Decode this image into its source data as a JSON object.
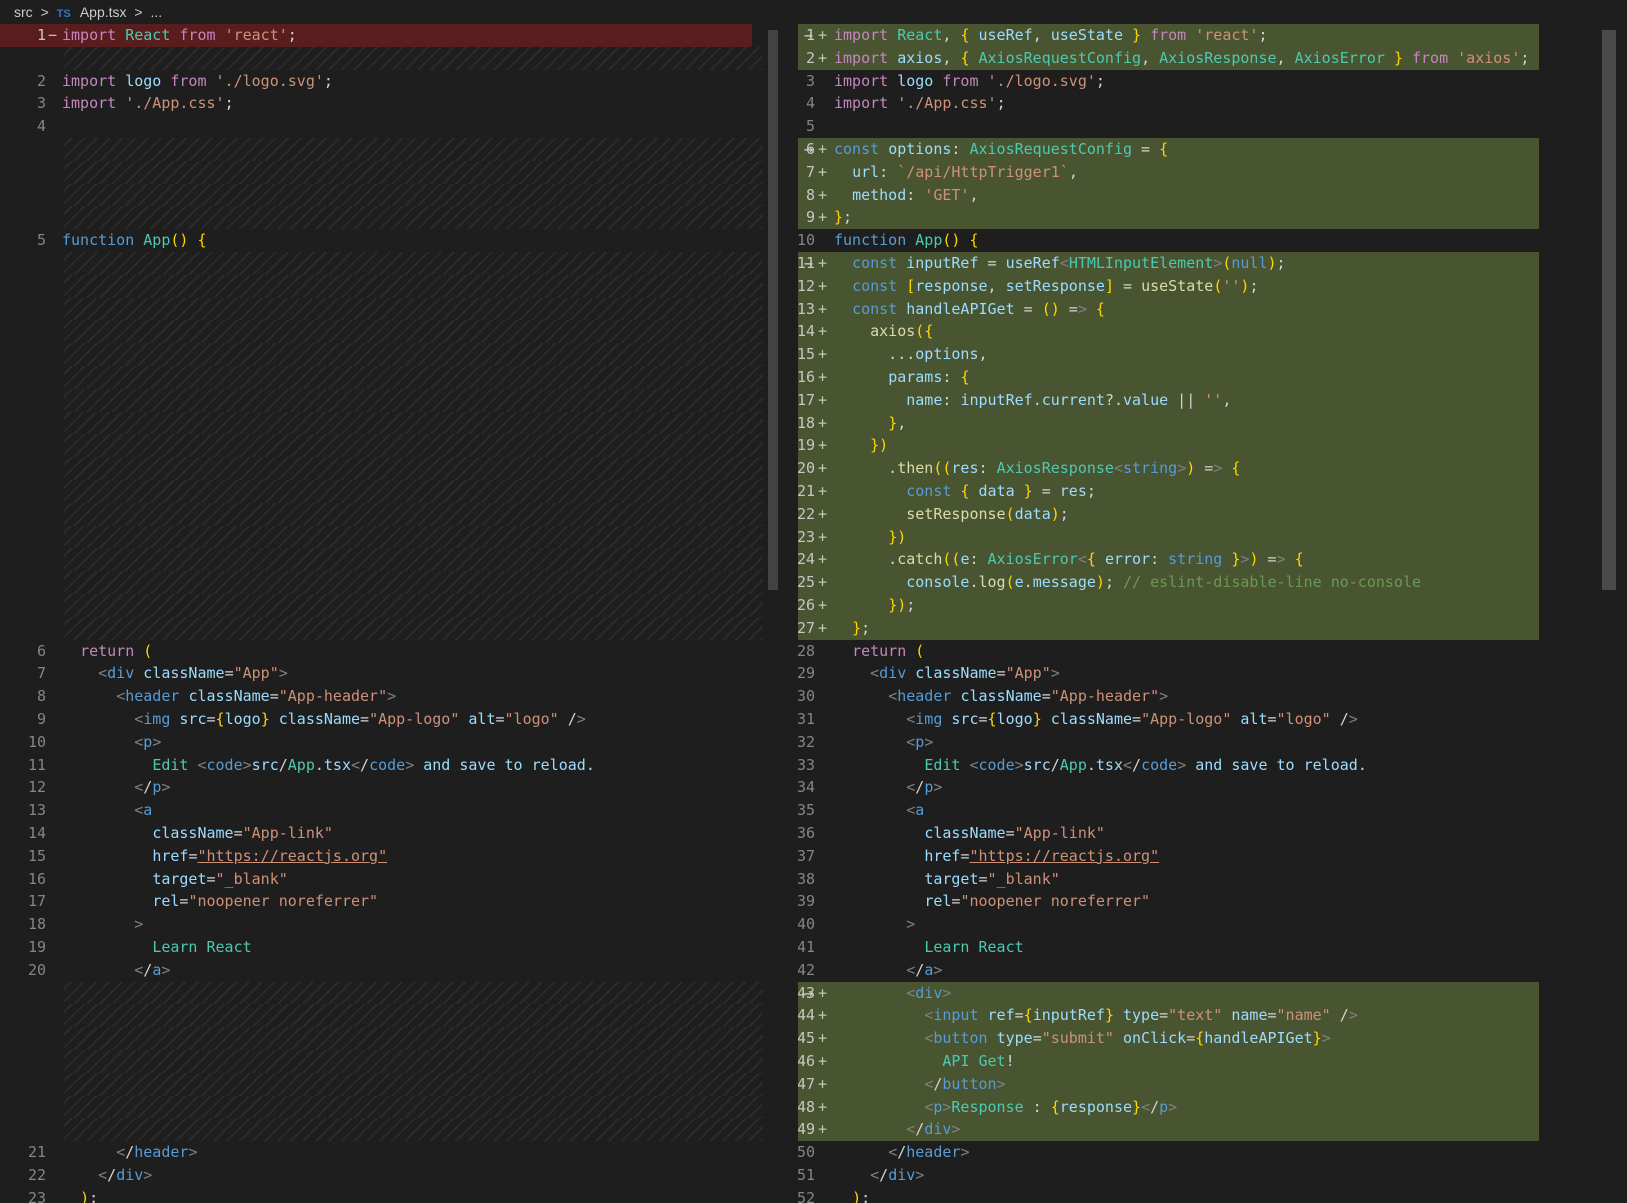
{
  "breadcrumb": {
    "folder": "src",
    "sep": ">",
    "lang": "TS",
    "file": "App.tsx",
    "tail": "..."
  },
  "left": [
    {
      "n": "1",
      "m": "−",
      "t": "import React from 'react';",
      "kind": "del"
    },
    {
      "kind": "fill"
    },
    {
      "n": "2",
      "t": "import logo from './logo.svg';"
    },
    {
      "n": "3",
      "t": "import './App.css';"
    },
    {
      "n": "4",
      "t": ""
    },
    {
      "kind": "fill"
    },
    {
      "kind": "fill"
    },
    {
      "kind": "fill"
    },
    {
      "kind": "fill"
    },
    {
      "n": "5",
      "t": "function App() {"
    },
    {
      "kind": "fill"
    },
    {
      "kind": "fill"
    },
    {
      "kind": "fill"
    },
    {
      "kind": "fill"
    },
    {
      "kind": "fill"
    },
    {
      "kind": "fill"
    },
    {
      "kind": "fill"
    },
    {
      "kind": "fill"
    },
    {
      "kind": "fill"
    },
    {
      "kind": "fill"
    },
    {
      "kind": "fill"
    },
    {
      "kind": "fill"
    },
    {
      "kind": "fill"
    },
    {
      "kind": "fill"
    },
    {
      "kind": "fill"
    },
    {
      "kind": "fill"
    },
    {
      "kind": "fill"
    },
    {
      "n": "6",
      "t": "  return ("
    },
    {
      "n": "7",
      "t": "    <div className=\"App\">"
    },
    {
      "n": "8",
      "t": "      <header className=\"App-header\">"
    },
    {
      "n": "9",
      "t": "        <img src={logo} className=\"App-logo\" alt=\"logo\" />"
    },
    {
      "n": "10",
      "t": "        <p>"
    },
    {
      "n": "11",
      "t": "          Edit <code>src/App.tsx</code> and save to reload."
    },
    {
      "n": "12",
      "t": "        </p>"
    },
    {
      "n": "13",
      "t": "        <a"
    },
    {
      "n": "14",
      "t": "          className=\"App-link\""
    },
    {
      "n": "15",
      "t": "          href=\"https://reactjs.org\""
    },
    {
      "n": "16",
      "t": "          target=\"_blank\""
    },
    {
      "n": "17",
      "t": "          rel=\"noopener noreferrer\""
    },
    {
      "n": "18",
      "t": "        >"
    },
    {
      "n": "19",
      "t": "          Learn React"
    },
    {
      "n": "20",
      "t": "        </a>"
    },
    {
      "kind": "fill"
    },
    {
      "kind": "fill"
    },
    {
      "kind": "fill"
    },
    {
      "kind": "fill"
    },
    {
      "kind": "fill"
    },
    {
      "kind": "fill"
    },
    {
      "kind": "fill"
    },
    {
      "n": "21",
      "t": "      </header>"
    },
    {
      "n": "22",
      "t": "    </div>"
    },
    {
      "n": "23",
      "t": "  );"
    }
  ],
  "right": [
    {
      "n": "1",
      "m": "+",
      "t": "import React, { useRef, useState } from 'react';",
      "kind": "ins",
      "arrow": true
    },
    {
      "n": "2",
      "m": "+",
      "t": "import axios, { AxiosRequestConfig, AxiosResponse, AxiosError } from 'axios';",
      "kind": "ins"
    },
    {
      "n": "3",
      "t": "import logo from './logo.svg';"
    },
    {
      "n": "4",
      "t": "import './App.css';"
    },
    {
      "n": "5",
      "t": ""
    },
    {
      "n": "6",
      "m": "+",
      "t": "const options: AxiosRequestConfig = {",
      "kind": "ins",
      "arrow": true
    },
    {
      "n": "7",
      "m": "+",
      "t": "  url: `/api/HttpTrigger1`,",
      "kind": "ins"
    },
    {
      "n": "8",
      "m": "+",
      "t": "  method: 'GET',",
      "kind": "ins"
    },
    {
      "n": "9",
      "m": "+",
      "t": "};",
      "kind": "ins"
    },
    {
      "n": "10",
      "t": "function App() {"
    },
    {
      "n": "11",
      "m": "+",
      "t": "  const inputRef = useRef<HTMLInputElement>(null);",
      "kind": "ins",
      "arrow": true
    },
    {
      "n": "12",
      "m": "+",
      "t": "  const [response, setResponse] = useState('');",
      "kind": "ins"
    },
    {
      "n": "13",
      "m": "+",
      "t": "  const handleAPIGet = () => {",
      "kind": "ins"
    },
    {
      "n": "14",
      "m": "+",
      "t": "    axios({",
      "kind": "ins"
    },
    {
      "n": "15",
      "m": "+",
      "t": "      ...options,",
      "kind": "ins"
    },
    {
      "n": "16",
      "m": "+",
      "t": "      params: {",
      "kind": "ins"
    },
    {
      "n": "17",
      "m": "+",
      "t": "        name: inputRef.current?.value || '',",
      "kind": "ins"
    },
    {
      "n": "18",
      "m": "+",
      "t": "      },",
      "kind": "ins"
    },
    {
      "n": "19",
      "m": "+",
      "t": "    })",
      "kind": "ins"
    },
    {
      "n": "20",
      "m": "+",
      "t": "      .then((res: AxiosResponse<string>) => {",
      "kind": "ins"
    },
    {
      "n": "21",
      "m": "+",
      "t": "        const { data } = res;",
      "kind": "ins"
    },
    {
      "n": "22",
      "m": "+",
      "t": "        setResponse(data);",
      "kind": "ins"
    },
    {
      "n": "23",
      "m": "+",
      "t": "      })",
      "kind": "ins"
    },
    {
      "n": "24",
      "m": "+",
      "t": "      .catch((e: AxiosError<{ error: string }>) => {",
      "kind": "ins"
    },
    {
      "n": "25",
      "m": "+",
      "t": "        console.log(e.message); // eslint-disable-line no-console",
      "kind": "ins"
    },
    {
      "n": "26",
      "m": "+",
      "t": "      });",
      "kind": "ins"
    },
    {
      "n": "27",
      "m": "+",
      "t": "  };",
      "kind": "ins"
    },
    {
      "n": "28",
      "t": "  return ("
    },
    {
      "n": "29",
      "t": "    <div className=\"App\">"
    },
    {
      "n": "30",
      "t": "      <header className=\"App-header\">"
    },
    {
      "n": "31",
      "t": "        <img src={logo} className=\"App-logo\" alt=\"logo\" />"
    },
    {
      "n": "32",
      "t": "        <p>"
    },
    {
      "n": "33",
      "t": "          Edit <code>src/App.tsx</code> and save to reload."
    },
    {
      "n": "34",
      "t": "        </p>"
    },
    {
      "n": "35",
      "t": "        <a"
    },
    {
      "n": "36",
      "t": "          className=\"App-link\""
    },
    {
      "n": "37",
      "t": "          href=\"https://reactjs.org\""
    },
    {
      "n": "38",
      "t": "          target=\"_blank\""
    },
    {
      "n": "39",
      "t": "          rel=\"noopener noreferrer\""
    },
    {
      "n": "40",
      "t": "        >"
    },
    {
      "n": "41",
      "t": "          Learn React"
    },
    {
      "n": "42",
      "t": "        </a>"
    },
    {
      "n": "43",
      "m": "+",
      "t": "        <div>",
      "kind": "ins",
      "arrow": true
    },
    {
      "n": "44",
      "m": "+",
      "t": "          <input ref={inputRef} type=\"text\" name=\"name\" />",
      "kind": "ins"
    },
    {
      "n": "45",
      "m": "+",
      "t": "          <button type=\"submit\" onClick={handleAPIGet}>",
      "kind": "ins"
    },
    {
      "n": "46",
      "m": "+",
      "t": "            API Get!",
      "kind": "ins"
    },
    {
      "n": "47",
      "m": "+",
      "t": "          </button>",
      "kind": "ins"
    },
    {
      "n": "48",
      "m": "+",
      "t": "          <p>Response : {response}</p>",
      "kind": "ins"
    },
    {
      "n": "49",
      "m": "+",
      "t": "        </div>",
      "kind": "ins"
    },
    {
      "n": "50",
      "t": "      </header>"
    },
    {
      "n": "51",
      "t": "    </div>"
    },
    {
      "n": "52",
      "t": "  );"
    }
  ],
  "arrow_glyph": "→"
}
